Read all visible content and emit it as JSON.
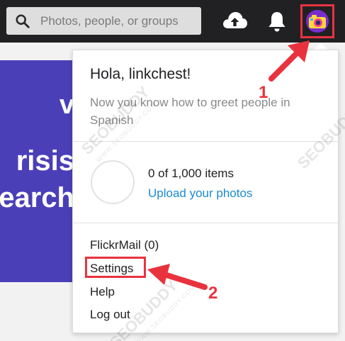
{
  "search": {
    "placeholder": "Photos, people, or groups"
  },
  "header": {
    "icons": [
      "search-icon",
      "cloud-upload-icon",
      "bell-icon",
      "camera-avatar-icon"
    ]
  },
  "hero": {
    "line1": "v",
    "line2": "risis",
    "line3": "earch"
  },
  "dropdown": {
    "greeting": "Hola, linkchest!",
    "greeting_sub": "Now you know how to greet people in Spanish",
    "storage": "0 of 1,000 items",
    "upload_link": "Upload your photos",
    "menu": [
      {
        "label": "FlickrMail (0)"
      },
      {
        "label": "Settings"
      },
      {
        "label": "Help"
      },
      {
        "label": "Log out"
      }
    ]
  },
  "annotations": {
    "badge1": "1",
    "badge2": "2",
    "color": "#e8333e"
  },
  "watermark": {
    "brand": "SEOBUDDY",
    "site": "WWW.SEOBUDDY.COM"
  },
  "colors": {
    "topbar": "#212124",
    "hero": "#4b3fb8",
    "link": "#1a8bd0",
    "annotation": "#e8333e"
  }
}
